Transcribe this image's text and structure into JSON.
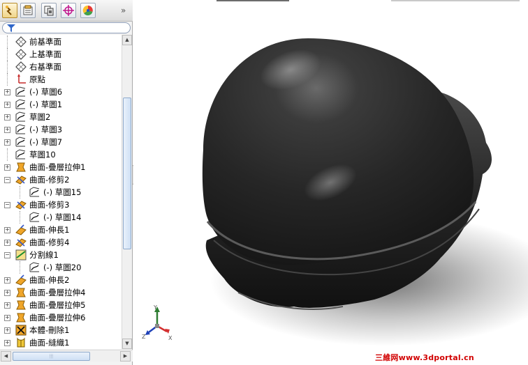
{
  "panel_tabs": [
    {
      "name": "featuremanager-tab",
      "icon": "feature-tree-icon"
    },
    {
      "name": "propertymanager-tab",
      "icon": "property-sheet-icon"
    },
    {
      "name": "configurationmanager-tab",
      "icon": "configuration-icon"
    },
    {
      "name": "dimxpert-tab",
      "icon": "crosshair-icon"
    },
    {
      "name": "display-manager-tab",
      "icon": "color-wheel-icon"
    }
  ],
  "more_tabs_glyph": "»",
  "filter_icon": "funnel-icon",
  "tree": [
    {
      "label": "前基準面",
      "icon": "plane-icon",
      "indent": 0,
      "expander": false
    },
    {
      "label": "上基準面",
      "icon": "plane-icon",
      "indent": 0,
      "expander": false
    },
    {
      "label": "右基準面",
      "icon": "plane-icon",
      "indent": 0,
      "expander": false
    },
    {
      "label": "原點",
      "icon": "origin-icon",
      "indent": 0,
      "expander": false
    },
    {
      "label": "(-) 草圖6",
      "icon": "sketch-icon",
      "indent": 0,
      "expander": "+"
    },
    {
      "label": "(-) 草圖1",
      "icon": "sketch-icon",
      "indent": 0,
      "expander": "+"
    },
    {
      "label": "草圖2",
      "icon": "sketch-icon",
      "indent": 0,
      "expander": "+"
    },
    {
      "label": "(-) 草圖3",
      "icon": "sketch-icon",
      "indent": 0,
      "expander": "+"
    },
    {
      "label": "(-) 草圖7",
      "icon": "sketch-icon",
      "indent": 0,
      "expander": "+"
    },
    {
      "label": "草圖10",
      "icon": "sketch-icon",
      "indent": 0,
      "expander": false
    },
    {
      "label": "曲面-疊層拉伸1",
      "icon": "loft-surface-icon",
      "indent": 0,
      "expander": "+"
    },
    {
      "label": "曲面-修剪2",
      "icon": "trim-surface-icon",
      "indent": 0,
      "expander": "-"
    },
    {
      "label": "(-) 草圖15",
      "icon": "sketch-icon",
      "indent": 1,
      "expander": false
    },
    {
      "label": "曲面-修剪3",
      "icon": "trim-surface-icon",
      "indent": 0,
      "expander": "-"
    },
    {
      "label": "(-) 草圖14",
      "icon": "sketch-icon",
      "indent": 1,
      "expander": false
    },
    {
      "label": "曲面-伸長1",
      "icon": "extend-surface-icon",
      "indent": 0,
      "expander": "+"
    },
    {
      "label": "曲面-修剪4",
      "icon": "trim-surface-icon",
      "indent": 0,
      "expander": "+"
    },
    {
      "label": "分割線1",
      "icon": "split-line-icon",
      "indent": 0,
      "expander": "-"
    },
    {
      "label": "(-) 草圖20",
      "icon": "sketch-icon",
      "indent": 1,
      "expander": false
    },
    {
      "label": "曲面-伸長2",
      "icon": "extend-surface-icon",
      "indent": 0,
      "expander": "+"
    },
    {
      "label": "曲面-疊層拉伸4",
      "icon": "loft-surface-icon",
      "indent": 0,
      "expander": "+"
    },
    {
      "label": "曲面-疊層拉伸5",
      "icon": "loft-surface-icon",
      "indent": 0,
      "expander": "+"
    },
    {
      "label": "曲面-疊層拉伸6",
      "icon": "loft-surface-icon",
      "indent": 0,
      "expander": "+"
    },
    {
      "label": "本體-刪除1",
      "icon": "delete-body-icon",
      "indent": 0,
      "expander": "+"
    },
    {
      "label": "曲面-縫織1",
      "icon": "knit-surface-icon",
      "indent": 0,
      "expander": "+"
    }
  ],
  "triad": {
    "y": "Y",
    "x": "X",
    "z": "Z"
  },
  "watermark": "三維网www.3dportal.cn",
  "colors": {
    "model": "#2a2a2a",
    "accent": "#d10000"
  }
}
